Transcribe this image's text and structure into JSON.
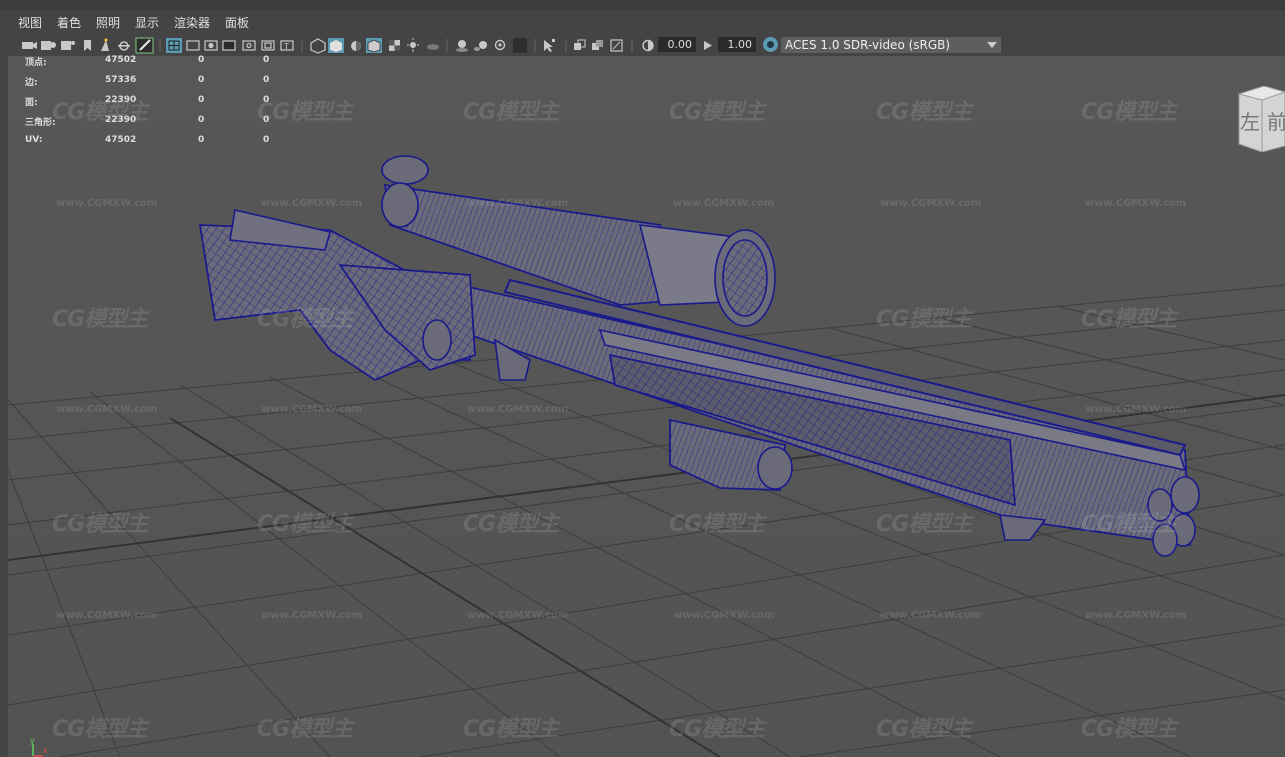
{
  "menu": [
    "视图",
    "着色",
    "照明",
    "显示",
    "渲染器",
    "面板"
  ],
  "toolbar": {
    "exposure_value": "0.00",
    "gamma_value": "1.00",
    "color_space": "ACES 1.0 SDR-video (sRGB)",
    "icons": [
      "select-camera-icon",
      "camera-attributes-icon",
      "bookmark-icon",
      "image-plane-icon",
      "2d-pan-zoom-icon",
      "grease-pencil-icon",
      "grid-icon",
      "film-gate-icon",
      "resolution-gate-icon",
      "gate-mask-icon",
      "field-chart-icon",
      "safe-action-icon",
      "safe-title-icon",
      "wireframe-icon",
      "smooth-shade-icon",
      "default-material-icon",
      "wireframe-on-shaded-icon",
      "textured-icon",
      "use-all-lights-icon",
      "shadows-icon",
      "ambient-occlusion-icon",
      "motion-blur-icon",
      "anti-aliasing-icon",
      "isolate-select-icon",
      "xray-icon",
      "xray-active-components-icon",
      "xray-joints-icon",
      "backface-culling-icon",
      "exposure-icon",
      "gamma-icon",
      "color-management-icon"
    ]
  },
  "hud": {
    "rows": [
      {
        "label": "顶点:",
        "total": "47502",
        "selected": "0",
        "mid": "0"
      },
      {
        "label": "边:",
        "total": "57336",
        "selected": "0",
        "mid": "0"
      },
      {
        "label": "面:",
        "total": "22390",
        "selected": "0",
        "mid": "0"
      },
      {
        "label": "三角形:",
        "total": "22390",
        "selected": "0",
        "mid": "0"
      },
      {
        "label": "UV:",
        "total": "47502",
        "selected": "0",
        "mid": "0"
      }
    ]
  },
  "watermark": {
    "logo": "CG模型主",
    "url": "www.CGMXW.com"
  },
  "viewcube": {
    "left_face": "左",
    "front_face": "前"
  },
  "axis": {
    "y": "y",
    "x": "x"
  },
  "colors": {
    "wire": "#1a1a8c",
    "mesh_fill": "#6a6a78",
    "grid": "#3a3a3a",
    "viewport_bg": "#565656",
    "selected_icon": "#5b9bb3"
  }
}
